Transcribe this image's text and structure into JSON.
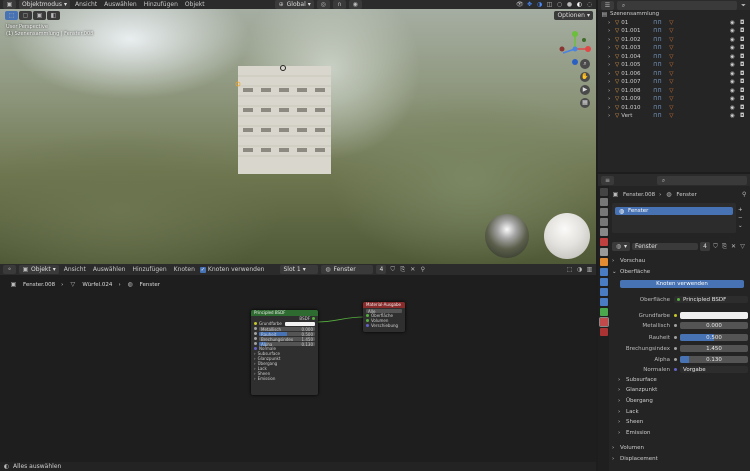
{
  "viewport_header": {
    "mode": "Objektmodus",
    "menus": [
      "Ansicht",
      "Auswählen",
      "Hinzufügen",
      "Objekt"
    ],
    "transform": "Global",
    "options": "Optionen"
  },
  "viewport": {
    "overlay_line1": "User Perspective",
    "overlay_line2": "(1) Szenensammlung | Fenster.008"
  },
  "node_header": {
    "editor": "Objekt",
    "menus": [
      "Ansicht",
      "Auswählen",
      "Hinzufügen",
      "Knoten"
    ],
    "use_nodes": "Knoten verwenden",
    "slot": "Slot 1",
    "material": "Fenster",
    "users": "4"
  },
  "breadcrumb": {
    "object": "Fenster.008",
    "mesh": "Würfel.024",
    "material": "Fenster"
  },
  "principled": {
    "title": "Principled BSDF",
    "out": "BSDF",
    "rows": [
      {
        "name": "Grundfarbe",
        "value": ""
      },
      {
        "name": "Metallisch",
        "value": "0.000"
      },
      {
        "name": "Rauheit",
        "value": "0.500"
      },
      {
        "name": "Brechungsindex",
        "value": "1.450"
      },
      {
        "name": "Alpha",
        "value": "0.130"
      },
      {
        "name": "Normale",
        "value": ""
      },
      {
        "name": "Subsurface",
        "value": ""
      },
      {
        "name": "Glanzpunkt",
        "value": ""
      },
      {
        "name": "Übergang",
        "value": ""
      },
      {
        "name": "Lack",
        "value": ""
      },
      {
        "name": "Sheen",
        "value": ""
      },
      {
        "name": "Emission",
        "value": ""
      }
    ]
  },
  "mat_output": {
    "title": "Material-Ausgabe",
    "target": "Alle",
    "rows": [
      "Oberfläche",
      "Volumen",
      "Verschiebung"
    ]
  },
  "outliner": {
    "search": "",
    "root": "Szenensammlung",
    "items": [
      "01",
      "01.001",
      "01.002",
      "01.003",
      "01.004",
      "01.005",
      "01.006",
      "01.007",
      "01.008",
      "01.009",
      "01.010",
      "Vert"
    ]
  },
  "properties": {
    "search": "",
    "breadcrumb_object": "Fenster.008",
    "breadcrumb_material": "Fenster",
    "slot_item": "Fenster",
    "material_name": "Fenster",
    "users": "4",
    "sections": {
      "preview": "Vorschau",
      "surface": "Oberfläche",
      "volume": "Volumen",
      "displacement": "Displacement"
    },
    "use_nodes_btn": "Knoten verwenden",
    "surface_label": "Oberfläche",
    "surface_value": "Principled BSDF",
    "fields": [
      {
        "label": "Grundfarbe",
        "value": ""
      },
      {
        "label": "Metallisch",
        "value": "0.000"
      },
      {
        "label": "Rauheit",
        "value": "0.500"
      },
      {
        "label": "Brechungsindex",
        "value": "1.450"
      },
      {
        "label": "Alpha",
        "value": "0.130"
      },
      {
        "label": "Normalen",
        "value": "Vorgabe"
      }
    ],
    "fill_fractions": {
      "metallic": 0.0,
      "roughness": 0.5,
      "alpha": 0.13
    },
    "subsections": [
      "Subsurface",
      "Glanzpunkt",
      "Übergang",
      "Lack",
      "Sheen",
      "Emission"
    ]
  },
  "status": {
    "left": "Alles auswählen"
  },
  "colors": {
    "accent": "#4772b3",
    "node_green": "#2e6b30",
    "node_red": "#8a2b2b",
    "socket_yellow": "#c7c729",
    "socket_gray": "#a1a1a1",
    "socket_purple": "#6363c7"
  }
}
